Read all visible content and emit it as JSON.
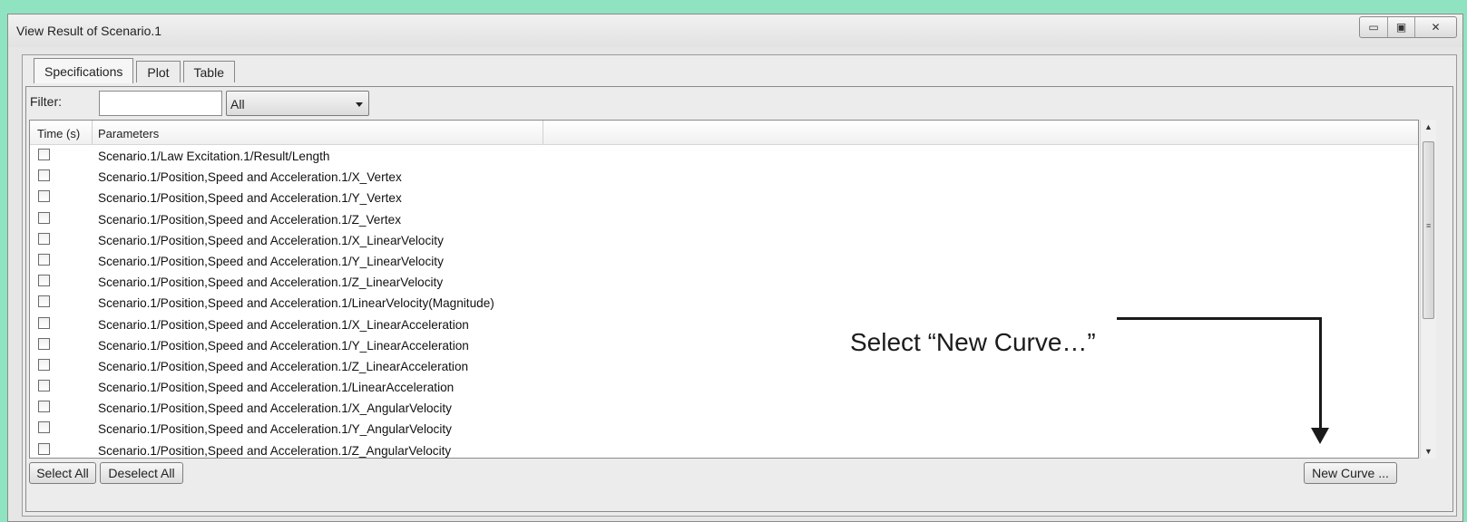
{
  "window": {
    "title": "View Result of Scenario.1",
    "controls": {
      "minimize": "▭",
      "maximize": "▣",
      "close": "✕"
    }
  },
  "tabs": [
    {
      "label": "Specifications",
      "active": true
    },
    {
      "label": "Plot",
      "active": false
    },
    {
      "label": "Table",
      "active": false
    }
  ],
  "filter": {
    "label": "Filter:",
    "input_value": "",
    "select_value": "All"
  },
  "list": {
    "columns": [
      "Time (s)",
      "Parameters"
    ],
    "rows": [
      "Scenario.1/Law Excitation.1/Result/Length",
      "Scenario.1/Position,Speed and Acceleration.1/X_Vertex",
      "Scenario.1/Position,Speed and Acceleration.1/Y_Vertex",
      "Scenario.1/Position,Speed and Acceleration.1/Z_Vertex",
      "Scenario.1/Position,Speed and Acceleration.1/X_LinearVelocity",
      "Scenario.1/Position,Speed and Acceleration.1/Y_LinearVelocity",
      "Scenario.1/Position,Speed and Acceleration.1/Z_LinearVelocity",
      "Scenario.1/Position,Speed and Acceleration.1/LinearVelocity(Magnitude)",
      "Scenario.1/Position,Speed and Acceleration.1/X_LinearAcceleration",
      "Scenario.1/Position,Speed and Acceleration.1/Y_LinearAcceleration",
      "Scenario.1/Position,Speed and Acceleration.1/Z_LinearAcceleration",
      "Scenario.1/Position,Speed and Acceleration.1/LinearAcceleration",
      "Scenario.1/Position,Speed and Acceleration.1/X_AngularVelocity",
      "Scenario.1/Position,Speed and Acceleration.1/Y_AngularVelocity",
      "Scenario.1/Position,Speed and Acceleration.1/Z_AngularVelocity"
    ]
  },
  "buttons": {
    "select_all": "Select All",
    "deselect_all": "Deselect All",
    "new_curve": "New Curve ..."
  },
  "annotation": {
    "text": "Select “New Curve…”"
  },
  "colors": {
    "background": "#8fe3c0",
    "window": "#e6e6e6",
    "annotation": "#1a1a1a"
  }
}
